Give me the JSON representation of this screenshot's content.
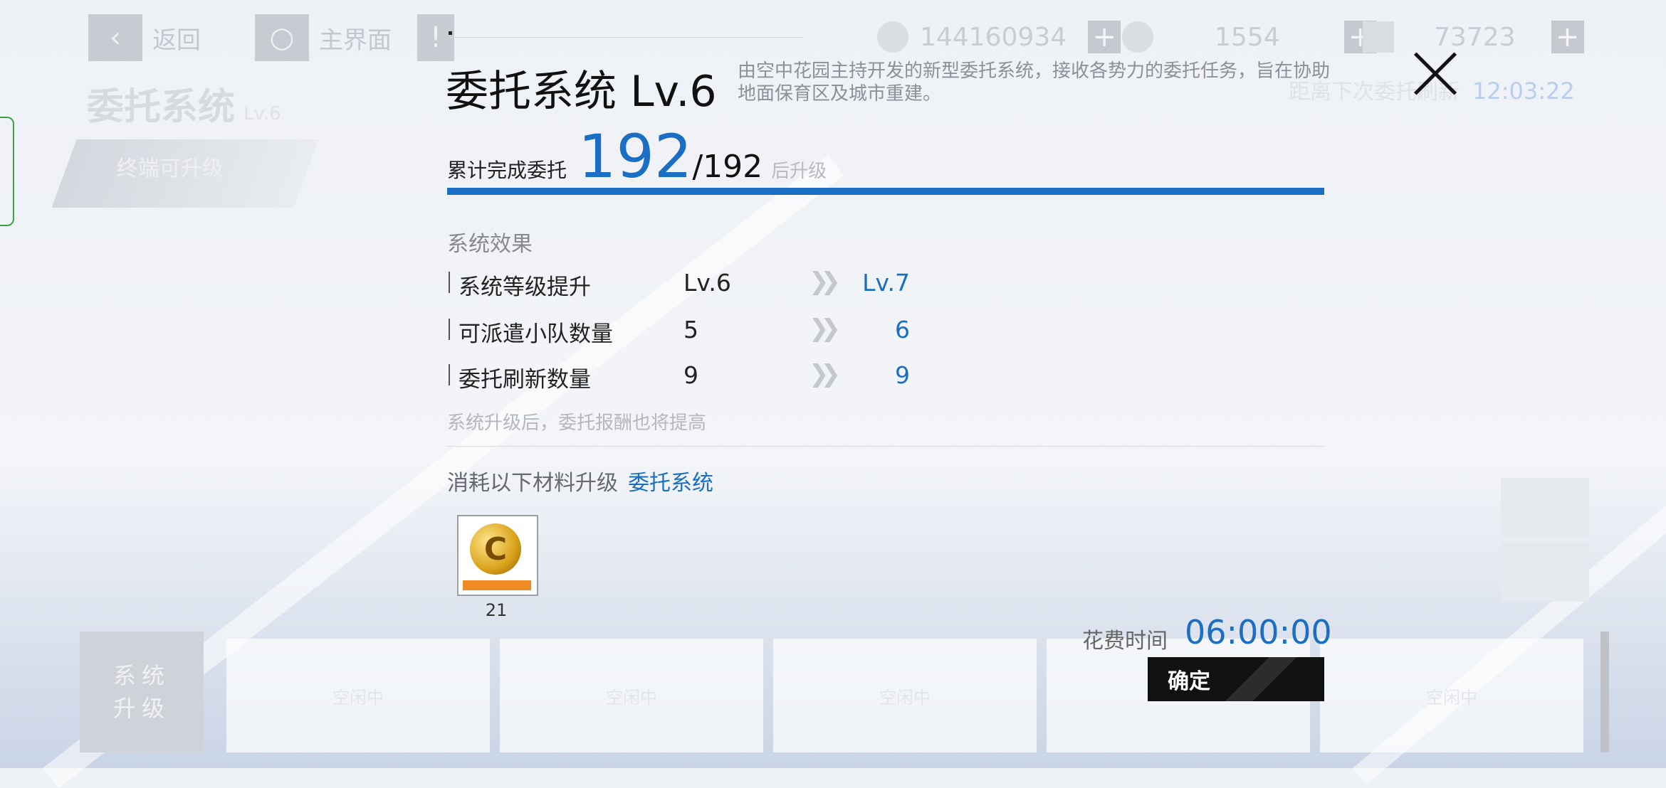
{
  "background": {
    "back_label": "返回",
    "home_label": "主界面",
    "resources": [
      {
        "icon": "coin-icon",
        "value": "144160934"
      },
      {
        "icon": "gold-medal-icon",
        "value": "1554"
      },
      {
        "icon": "paper-plane-icon",
        "value": "73723"
      }
    ],
    "page_title": "委托系统",
    "page_level": "Lv.6",
    "upgrade_tag": "终端可升级",
    "next_refresh_label": "距离下次委托刷新",
    "next_refresh_time": "12:03:22",
    "system_upgrade_button": "系统升级",
    "slot_label": "空闲中"
  },
  "modal": {
    "title": "委托系统 Lv.6",
    "description": "由空中花园主持开发的新型委托系统，接收各势力的委托任务，旨在协助地面保育区及城市重建。",
    "progress": {
      "label": "累计完成委托",
      "current": "192",
      "total": "/192",
      "suffix": "后升级",
      "fraction": 1.0
    },
    "effects_title": "系统效果",
    "effects": [
      {
        "name": "系统等级提升",
        "from": "Lv.6",
        "to": "Lv.7"
      },
      {
        "name": "可派遣小队数量",
        "from": "5",
        "to": "6"
      },
      {
        "name": "委托刷新数量",
        "from": "9",
        "to": "9"
      }
    ],
    "effects_note": "系统升级后，委托报酬也将提高",
    "consume_label": "消耗以下材料升级",
    "consume_target": "委托系统",
    "material": {
      "icon": "gold-coin-icon",
      "count": "21"
    },
    "time_label": "花费时间",
    "time_value": "06:00:00",
    "confirm_label": "确定"
  },
  "colors": {
    "accent": "#1a6fc4",
    "confirm_bg": "#111111"
  }
}
